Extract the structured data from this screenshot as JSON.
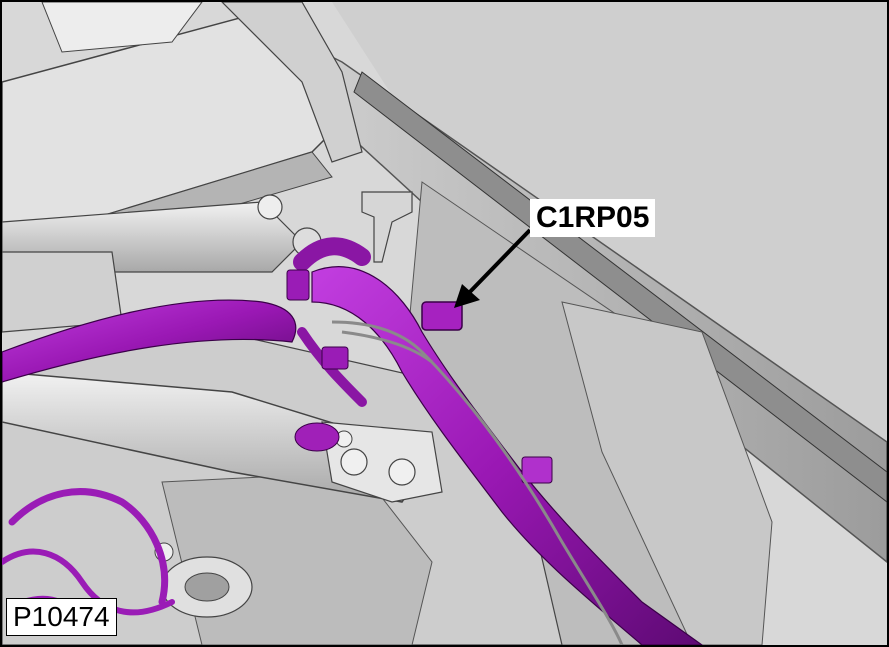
{
  "callout": {
    "label": "C1RP05"
  },
  "figure": {
    "id": "P10474"
  },
  "colors": {
    "harness": "#a020b8",
    "harness_dark": "#6a0a80",
    "metal_light": "#e6e6e6",
    "metal_mid": "#bcbcbc",
    "metal_dark": "#7a7a7a",
    "background": "#d6d6d6"
  }
}
